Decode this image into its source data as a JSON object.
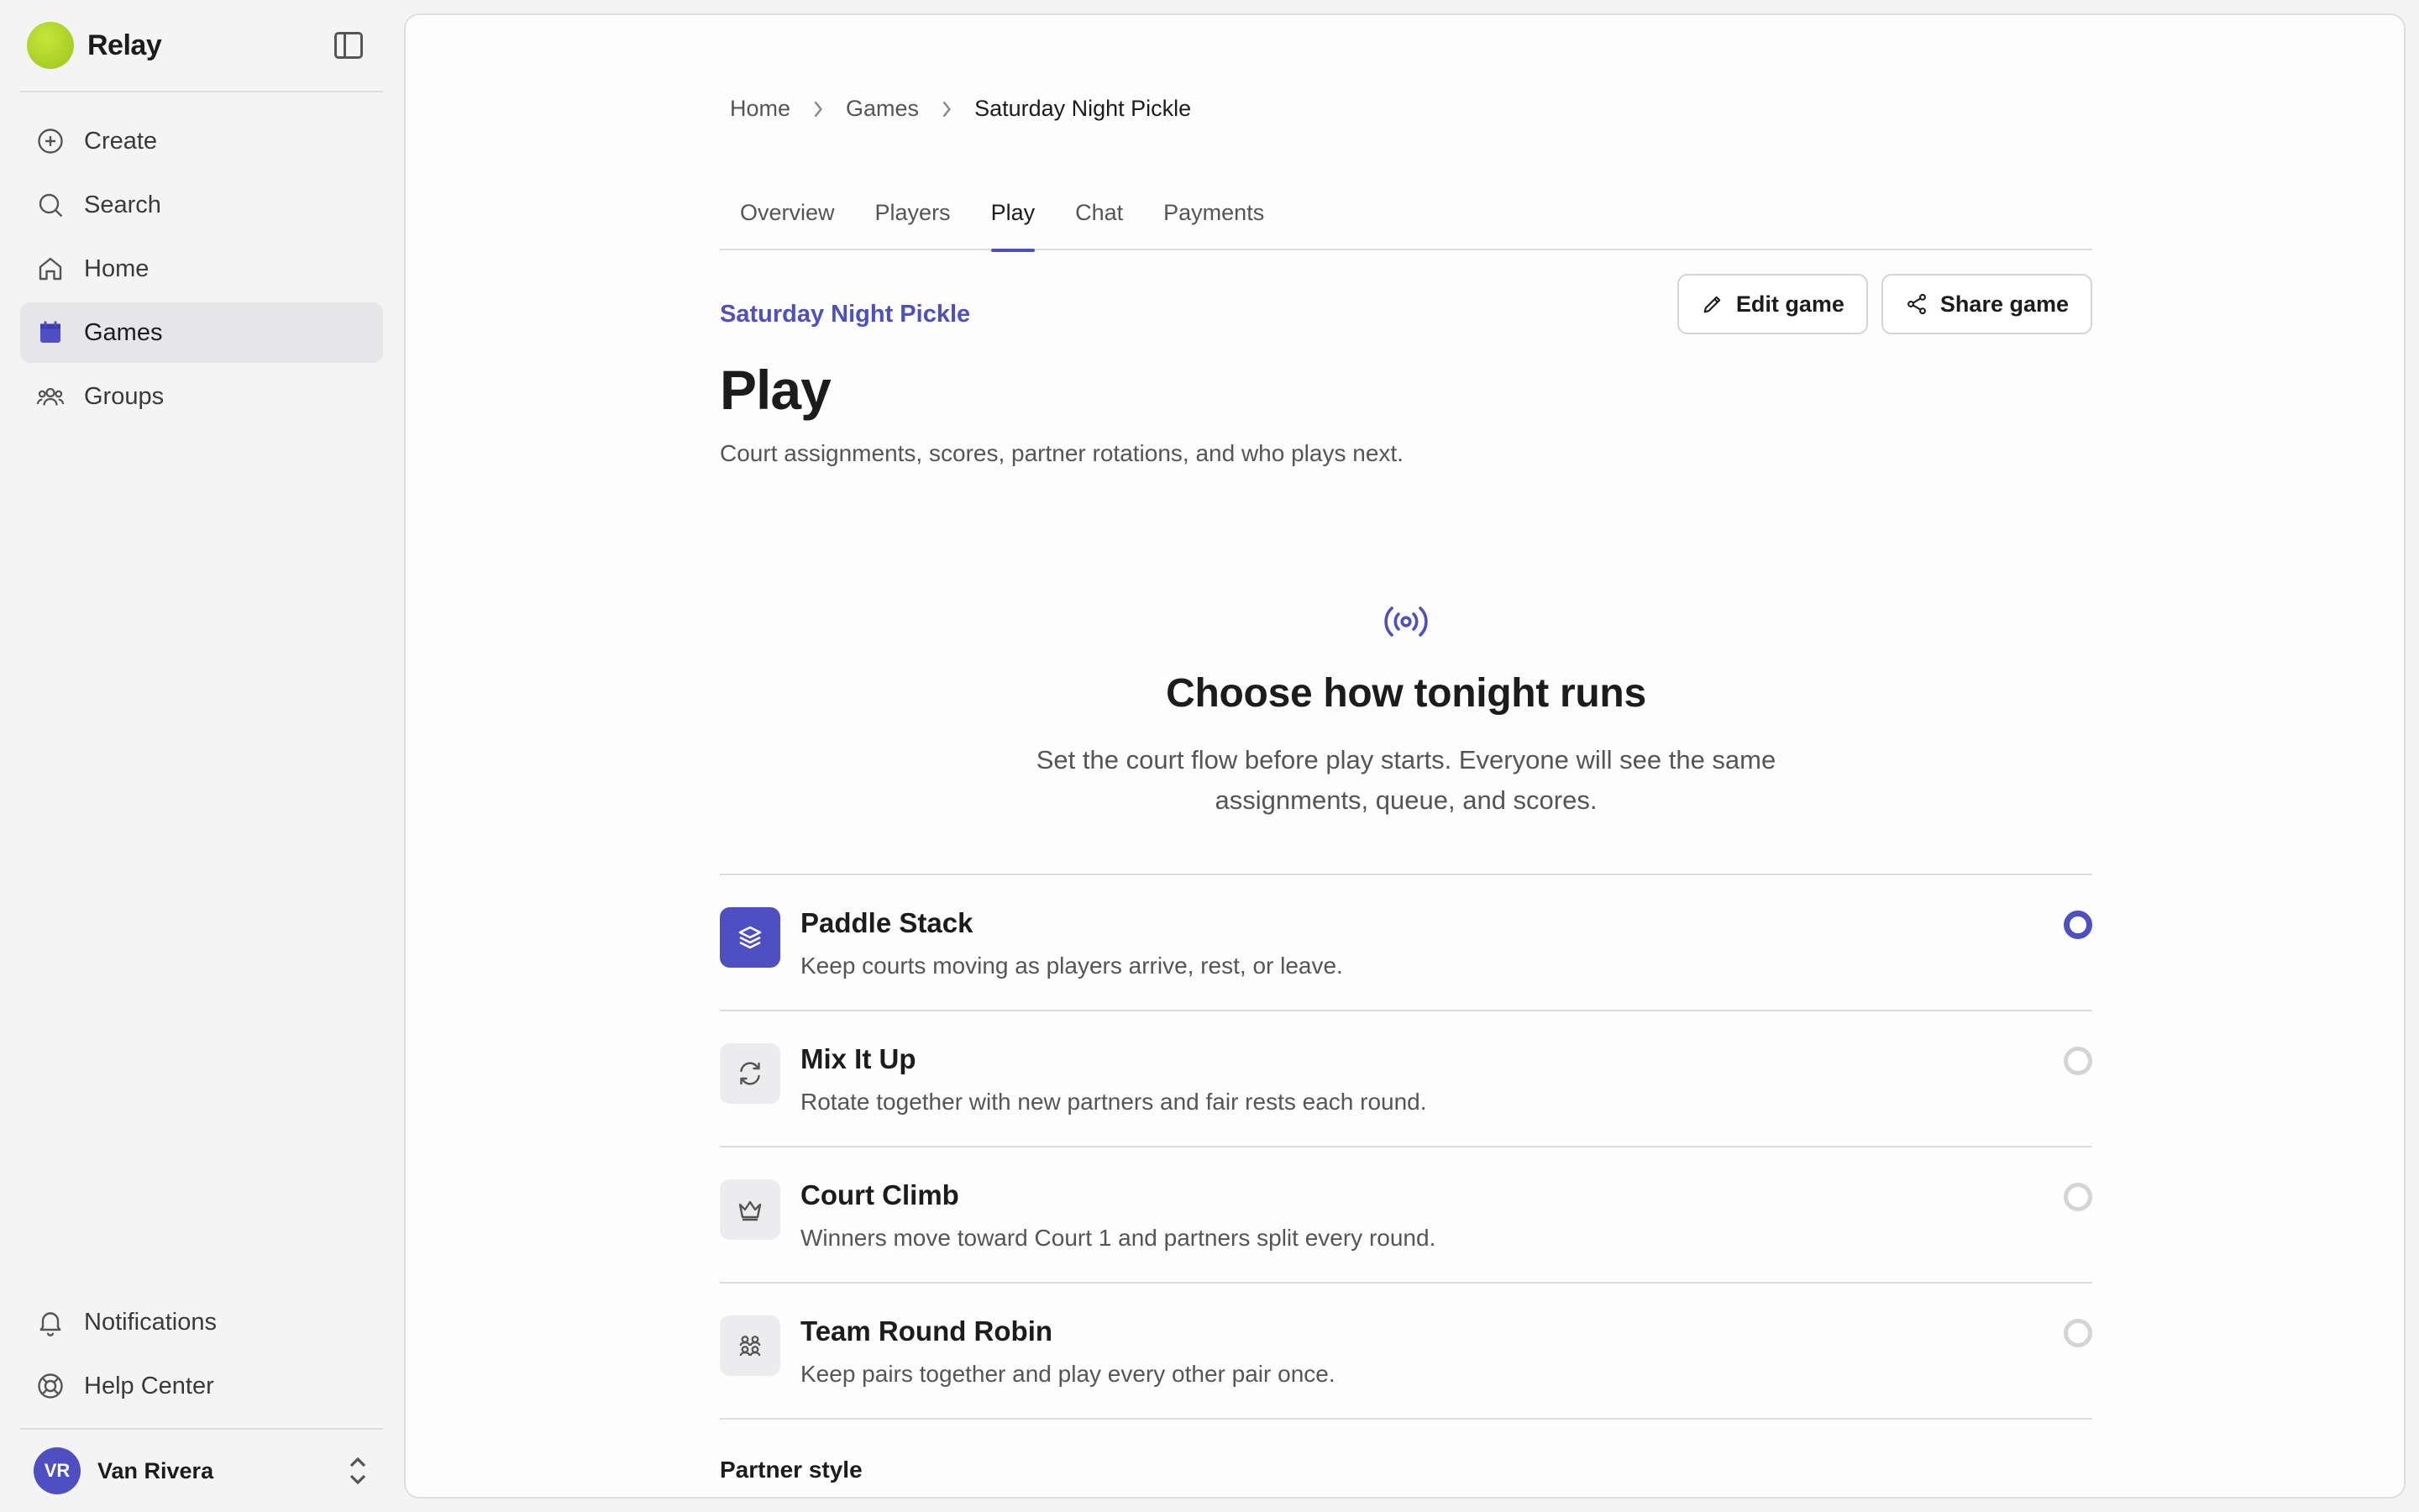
{
  "brand": {
    "name": "Relay"
  },
  "sidebar": {
    "items": [
      {
        "label": "Create",
        "icon": "plus-circle-icon"
      },
      {
        "label": "Search",
        "icon": "search-icon"
      },
      {
        "label": "Home",
        "icon": "home-icon"
      },
      {
        "label": "Games",
        "icon": "calendar-icon",
        "active": true
      },
      {
        "label": "Groups",
        "icon": "users-icon"
      }
    ],
    "bottom_items": [
      {
        "label": "Notifications",
        "icon": "bell-icon"
      },
      {
        "label": "Help Center",
        "icon": "lifebuoy-icon"
      }
    ],
    "user": {
      "initials": "VR",
      "name": "Van Rivera"
    }
  },
  "breadcrumb": [
    "Home",
    "Games",
    "Saturday Night Pickle"
  ],
  "tabs": [
    "Overview",
    "Players",
    "Play",
    "Chat",
    "Payments"
  ],
  "active_tab": "Play",
  "header": {
    "eyebrow": "Saturday Night Pickle",
    "title": "Play",
    "subtitle": "Court assignments, scores, partner rotations, and who plays next.",
    "edit_label": "Edit game",
    "share_label": "Share game"
  },
  "empty_state": {
    "icon": "broadcast-icon",
    "title": "Choose how tonight runs",
    "description": "Set the court flow before play starts. Everyone will see the same assignments, queue, and scores."
  },
  "options": [
    {
      "title": "Paddle Stack",
      "description": "Keep courts moving as players arrive, rest, or leave.",
      "icon": "layers-icon",
      "selected": true
    },
    {
      "title": "Mix It Up",
      "description": "Rotate together with new partners and fair rests each round.",
      "icon": "refresh-icon",
      "selected": false
    },
    {
      "title": "Court Climb",
      "description": "Winners move toward Court 1 and partners split every round.",
      "icon": "crown-icon",
      "selected": false
    },
    {
      "title": "Team Round Robin",
      "description": "Keep pairs together and play every other pair once.",
      "icon": "group-icon",
      "selected": false
    }
  ],
  "partner_style": {
    "label": "Partner style"
  },
  "colors": {
    "accent": "#4d4fc2",
    "brand_logo": "#b3d92a"
  }
}
